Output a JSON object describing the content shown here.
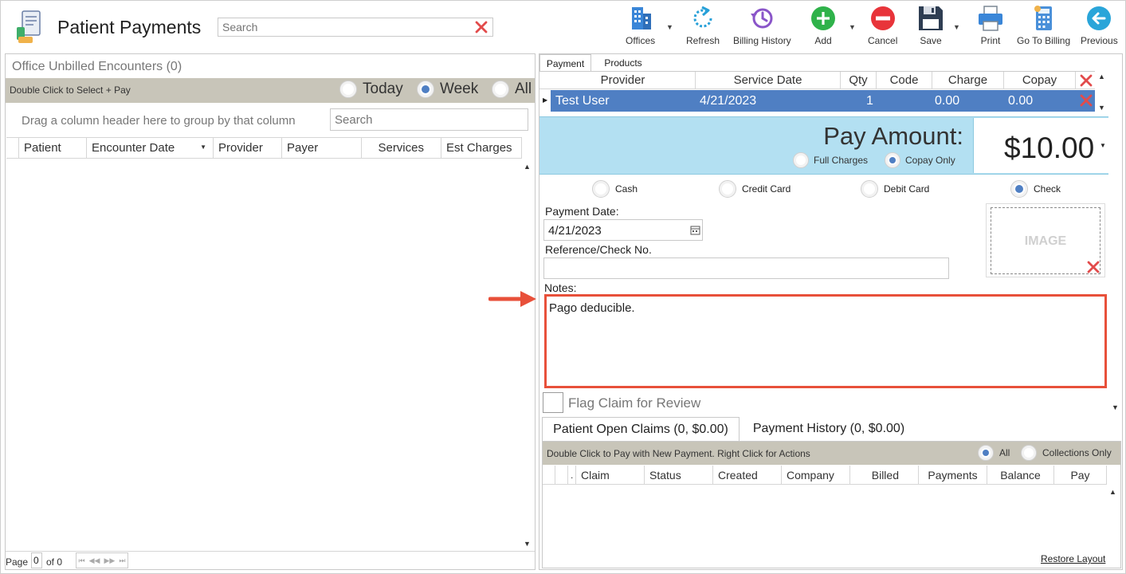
{
  "app": {
    "title": "Patient Payments",
    "search_placeholder": "Search"
  },
  "toolbar": [
    {
      "id": "offices",
      "label": "Offices"
    },
    {
      "id": "refresh",
      "label": "Refresh"
    },
    {
      "id": "billing-history",
      "label": "Billing History"
    },
    {
      "id": "add",
      "label": "Add"
    },
    {
      "id": "cancel",
      "label": "Cancel"
    },
    {
      "id": "save",
      "label": "Save"
    },
    {
      "id": "print",
      "label": "Print"
    },
    {
      "id": "go-to-billing",
      "label": "Go To Billing"
    },
    {
      "id": "previous",
      "label": "Previous"
    }
  ],
  "left": {
    "title": "Office Unbilled Encounters (0)",
    "band_text": "Double Click to Select + Pay",
    "filters": [
      {
        "label": "Today",
        "selected": false
      },
      {
        "label": "Week",
        "selected": true
      },
      {
        "label": "All",
        "selected": false
      }
    ],
    "group_hint": "Drag a column header here to group by that column",
    "search_placeholder": "Search",
    "columns": [
      "Patient",
      "Encounter Date",
      "Provider",
      "Payer",
      "Services",
      "Est Charges"
    ],
    "pager": {
      "page_label": "Page",
      "page_value": "0",
      "of_label": "of 0"
    }
  },
  "right": {
    "tabs": [
      "Payment",
      "Products"
    ],
    "grid_columns": [
      "Provider",
      "Service Date",
      "Qty",
      "Code",
      "Charge",
      "Copay"
    ],
    "grid_row": {
      "provider": "Test User",
      "service_date": "4/21/2023",
      "qty": "1",
      "code": "",
      "charge": "0.00",
      "copay": "0.00"
    },
    "pay_amount_label": "Pay Amount:",
    "pay_amount_value": "$10.00",
    "charge_options": [
      {
        "label": "Full Charges",
        "selected": false
      },
      {
        "label": "Copay Only",
        "selected": true
      }
    ],
    "methods": [
      {
        "label": "Cash",
        "selected": false
      },
      {
        "label": "Credit Card",
        "selected": false
      },
      {
        "label": "Debit Card",
        "selected": false
      },
      {
        "label": "Check",
        "selected": true
      }
    ],
    "payment_date_label": "Payment Date:",
    "payment_date_value": "4/21/2023",
    "reference_label": "Reference/Check No.",
    "reference_value": "",
    "image_label": "IMAGE",
    "notes_label": "Notes:",
    "notes_value": "Pago deducible.",
    "flag_label": "Flag Claim for Review",
    "bottom_tabs": [
      "Patient Open Claims (0, $0.00)",
      "Payment History (0, $0.00)"
    ],
    "claims_band_text": "Double Click to Pay with New Payment. Right Click for Actions",
    "claims_filters": [
      {
        "label": "All",
        "selected": true
      },
      {
        "label": "Collections Only",
        "selected": false
      }
    ],
    "claims_columns": [
      ".",
      "Claim",
      "Status",
      "Created",
      "Company",
      "Billed",
      "Payments",
      "Balance",
      "Pay"
    ],
    "restore_layout": "Restore Layout"
  },
  "colors": {
    "accent": "#4f7fc3",
    "band": "#c8c5b9",
    "selected_row": "#4f7fc3",
    "pay_band": "#b3e0f2",
    "highlight": "#e8503a"
  }
}
